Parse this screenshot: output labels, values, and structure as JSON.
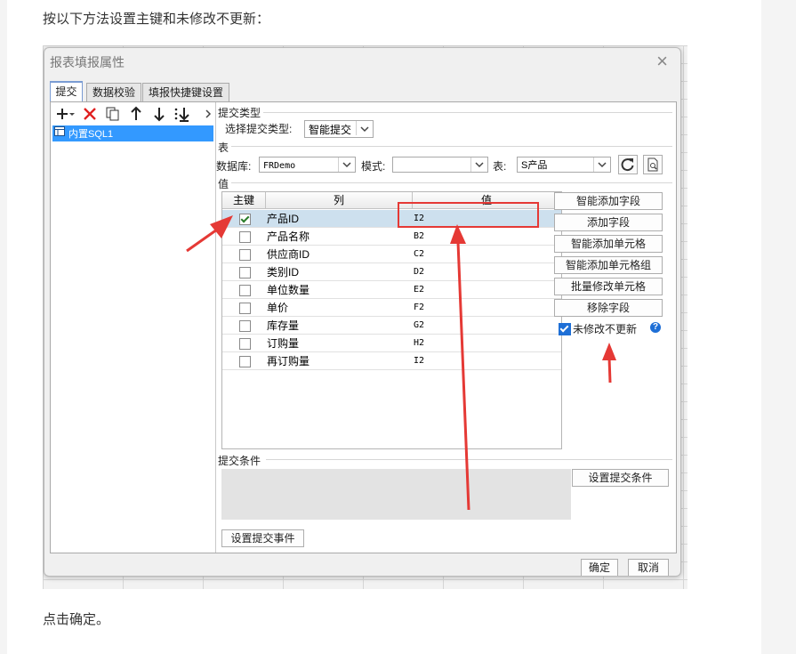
{
  "article": {
    "intro_text": "按以下方法设置主键和未修改不更新：",
    "outro_text": "点击确定。"
  },
  "dialog": {
    "title": "报表填报属性",
    "close_glyph": "×",
    "tabs": [
      {
        "label": "提交",
        "active": true
      },
      {
        "label": "数据校验",
        "active": false
      },
      {
        "label": "填报快捷键设置",
        "active": false
      }
    ],
    "toolbar_icons": [
      "add-icon",
      "delete-icon",
      "copy-icon",
      "move-up-icon",
      "move-down-icon",
      "move-bottom-icon"
    ],
    "source_list": [
      "内置SQL1"
    ],
    "submit_type": {
      "section_label": "提交类型",
      "label": "选择提交类型:",
      "value": "智能提交"
    },
    "table_section": {
      "section_label": "表",
      "db_label": "数据库:",
      "db_value": "FRDemo",
      "mode_label": "模式:",
      "mode_value": "",
      "table_label": "表:",
      "table_value": "S产品"
    },
    "value_section": {
      "section_label": "值",
      "headers": [
        "主键",
        "列",
        "值"
      ],
      "rows": [
        {
          "key": true,
          "column": "产品ID",
          "value": "I2",
          "selected": true
        },
        {
          "key": false,
          "column": "产品名称",
          "value": "B2",
          "selected": false
        },
        {
          "key": false,
          "column": "供应商ID",
          "value": "C2",
          "selected": false
        },
        {
          "key": false,
          "column": "类别ID",
          "value": "D2",
          "selected": false
        },
        {
          "key": false,
          "column": "单位数量",
          "value": "E2",
          "selected": false
        },
        {
          "key": false,
          "column": "单价",
          "value": "F2",
          "selected": false
        },
        {
          "key": false,
          "column": "库存量",
          "value": "G2",
          "selected": false
        },
        {
          "key": false,
          "column": "订购量",
          "value": "H2",
          "selected": false
        },
        {
          "key": false,
          "column": "再订购量",
          "value": "I2",
          "selected": false
        }
      ]
    },
    "side_buttons": [
      "智能添加字段",
      "添加字段",
      "智能添加单元格",
      "智能添加单元格组",
      "批量修改单元格",
      "移除字段"
    ],
    "no_update_unmodified": {
      "label": "未修改不更新",
      "checked": true,
      "help": "?"
    },
    "submit_condition": {
      "section_label": "提交条件",
      "button": "设置提交条件"
    },
    "submit_event_button": "设置提交事件",
    "ok_button": "确定",
    "cancel_button": "取消"
  },
  "colors": {
    "annotation_red": "#e53935",
    "selection_blue": "#3399ff",
    "row_highlight": "#cde0ee"
  }
}
